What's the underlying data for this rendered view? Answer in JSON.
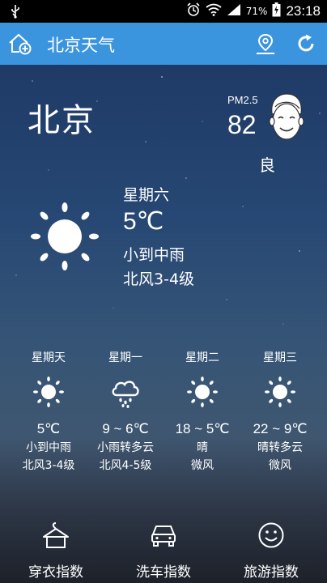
{
  "status_bar": {
    "time": "23:18",
    "battery_percent": "71%",
    "left_icon": "usb-icon",
    "right_icons": [
      "alarm-icon",
      "wifi-icon",
      "signal-icon",
      "battery-charging-icon"
    ]
  },
  "app_bar": {
    "title": "北京天气",
    "home_icon": "home-add-icon",
    "location_icon": "location-pin-icon",
    "refresh_icon": "refresh-icon",
    "bg_color": "#3b95de"
  },
  "current": {
    "city": "北京",
    "pm_label": "PM2.5",
    "pm_value": "82",
    "air_quality": "良",
    "air_quality_icon": "smiling-face-icon",
    "day": "星期六",
    "temperature": "5℃",
    "condition": "小到中雨",
    "wind": "北风3-4级",
    "icon": "sun-icon"
  },
  "forecast": [
    {
      "day": "星期天",
      "icon": "sun-icon",
      "temp": "5℃",
      "condition": "小到中雨",
      "wind": "北风3-4级"
    },
    {
      "day": "星期一",
      "icon": "rain-cloud-icon",
      "temp": "9 ~ 6℃",
      "condition": "小雨转多云",
      "wind": "北风4-5级"
    },
    {
      "day": "星期二",
      "icon": "sun-icon",
      "temp": "18 ~ 5℃",
      "condition": "晴",
      "wind": "微风"
    },
    {
      "day": "星期三",
      "icon": "sun-icon",
      "temp": "22 ~ 9℃",
      "condition": "晴转多云",
      "wind": "微风"
    }
  ],
  "bottom_nav": [
    {
      "label": "穿衣指数",
      "icon": "clothing-icon"
    },
    {
      "label": "洗车指数",
      "icon": "car-icon"
    },
    {
      "label": "旅游指数",
      "icon": "smiley-icon"
    }
  ]
}
